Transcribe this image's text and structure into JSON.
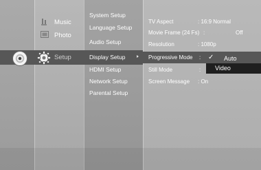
{
  "main_menu": {
    "items": [
      {
        "label": "Music"
      },
      {
        "label": "Photo"
      },
      {
        "label": "Setup"
      }
    ]
  },
  "setup_menu": {
    "items": [
      {
        "label": "System Setup"
      },
      {
        "label": "Language Setup"
      },
      {
        "label": "Audio Setup"
      },
      {
        "label": "Display Setup"
      },
      {
        "label": "HDMI Setup"
      },
      {
        "label": "Network Setup"
      },
      {
        "label": "Parental Setup"
      }
    ]
  },
  "display_settings": {
    "rows": [
      {
        "label": "TV Aspect",
        "value": ": 16:9 Normal"
      },
      {
        "label": "Movie Frame (24 Fs)",
        "value": ":",
        "extra": "Off"
      },
      {
        "label": "Resolution",
        "value": ": 1080p"
      },
      {
        "label": "Progressive Mode",
        "value": ":"
      },
      {
        "label": "Still Mode",
        "value": ":"
      },
      {
        "label": "Screen Message",
        "value": ": On"
      }
    ]
  },
  "progressive_popup": {
    "options": [
      "Auto",
      "Video"
    ],
    "selected": "Auto"
  },
  "colors": {
    "background": "#aaaaaa",
    "highlight_row": "#575757",
    "popup_focus": "#1f1f1f",
    "text": "#ffffff"
  }
}
